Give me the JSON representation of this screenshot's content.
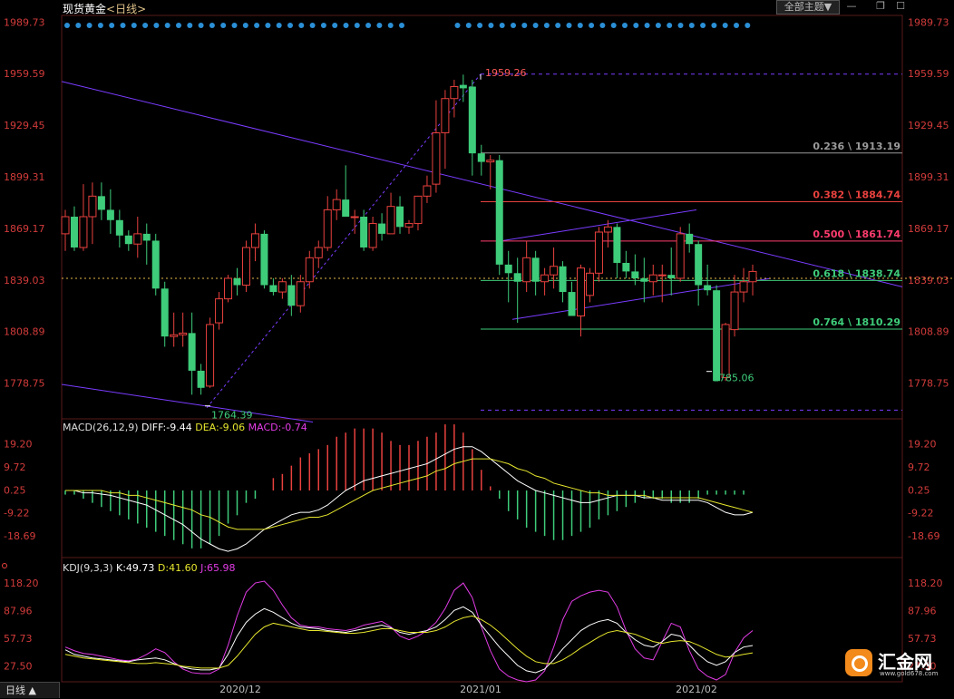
{
  "header": {
    "title": "现货黄金",
    "title_sub": "<日线>",
    "theme_label": "全部主题▼",
    "win_min": "—",
    "win_restore": "❐",
    "win_close": "☐"
  },
  "colors": {
    "up": "#e8413e",
    "down": "#3ecc7a",
    "bg": "#000000",
    "axis_text": "#d33b3b",
    "trend": "#7a3cff",
    "white_line": "#ffffff",
    "yellow_line": "#e6e62e",
    "magenta_line": "#e23ce6",
    "dot": "#2b8fd6"
  },
  "chart_data": [
    {
      "type": "candlestick",
      "title": "现货黄金 日线",
      "ylim": [
        1760,
        1992
      ],
      "y_ticks": [
        "1989.73",
        "1959.59",
        "1929.45",
        "1899.31",
        "1869.17",
        "1839.03",
        "1808.89",
        "1778.75"
      ],
      "x_ticks": [
        "2020/12",
        "2021/01",
        "2021/02"
      ],
      "current_price": 1840,
      "fib_levels": [
        {
          "label": "0.236 \\ 1913.19",
          "value": 1913.19,
          "color": "#9a9a9a"
        },
        {
          "label": "0.382 \\ 1884.74",
          "value": 1884.74,
          "color": "#e8413e"
        },
        {
          "label": "0.500 \\ 1861.74",
          "value": 1861.74,
          "color": "#ff3c6e"
        },
        {
          "label": "0.618 \\ 1838.74",
          "value": 1838.74,
          "color": "#3ecc7a"
        },
        {
          "label": "0.764 \\ 1810.29",
          "value": 1810.29,
          "color": "#3ecc7a"
        }
      ],
      "annotations": [
        {
          "label": "1959.26",
          "value": 1959.26
        },
        {
          "label": "1764.39",
          "value": 1764.39
        },
        {
          "label": "1785.06",
          "value": 1785.06
        }
      ],
      "ohlc": [
        [
          1866,
          1880,
          1856,
          1876
        ],
        [
          1876,
          1882,
          1856,
          1858
        ],
        [
          1858,
          1895,
          1856,
          1876
        ],
        [
          1876,
          1896,
          1860,
          1888
        ],
        [
          1888,
          1896,
          1874,
          1880
        ],
        [
          1880,
          1892,
          1866,
          1874
        ],
        [
          1874,
          1880,
          1858,
          1865
        ],
        [
          1865,
          1868,
          1856,
          1860
        ],
        [
          1860,
          1876,
          1852,
          1866
        ],
        [
          1866,
          1872,
          1848,
          1862
        ],
        [
          1862,
          1866,
          1830,
          1834
        ],
        [
          1834,
          1838,
          1800,
          1806
        ],
        [
          1806,
          1820,
          1800,
          1807
        ],
        [
          1807,
          1820,
          1800,
          1808
        ],
        [
          1808,
          1820,
          1772,
          1786
        ],
        [
          1786,
          1790,
          1772,
          1776
        ],
        [
          1777,
          1817,
          1776,
          1813
        ],
        [
          1814,
          1832,
          1810,
          1828
        ],
        [
          1828,
          1842,
          1826,
          1840
        ],
        [
          1840,
          1846,
          1830,
          1836
        ],
        [
          1836,
          1862,
          1832,
          1858
        ],
        [
          1858,
          1872,
          1850,
          1866
        ],
        [
          1866,
          1868,
          1834,
          1836
        ],
        [
          1836,
          1840,
          1830,
          1832
        ],
        [
          1832,
          1840,
          1828,
          1838
        ],
        [
          1836,
          1842,
          1818,
          1824
        ],
        [
          1824,
          1842,
          1820,
          1838
        ],
        [
          1838,
          1856,
          1834,
          1852
        ],
        [
          1852,
          1862,
          1846,
          1858
        ],
        [
          1858,
          1888,
          1856,
          1880
        ],
        [
          1880,
          1892,
          1874,
          1886
        ],
        [
          1886,
          1906,
          1876,
          1876
        ],
        [
          1876,
          1880,
          1866,
          1876
        ],
        [
          1876,
          1880,
          1856,
          1858
        ],
        [
          1858,
          1876,
          1856,
          1872
        ],
        [
          1872,
          1878,
          1862,
          1866
        ],
        [
          1866,
          1890,
          1866,
          1882
        ],
        [
          1882,
          1888,
          1866,
          1870
        ],
        [
          1870,
          1874,
          1866,
          1872
        ],
        [
          1872,
          1888,
          1868,
          1888
        ],
        [
          1888,
          1900,
          1884,
          1894
        ],
        [
          1895,
          1944,
          1890,
          1925
        ],
        [
          1925,
          1950,
          1904,
          1945
        ],
        [
          1945,
          1956,
          1934,
          1952
        ],
        [
          1953,
          1959,
          1943,
          1951
        ],
        [
          1952,
          1956,
          1900,
          1913
        ],
        [
          1913,
          1918,
          1900,
          1908
        ],
        [
          1908,
          1912,
          1892,
          1909
        ],
        [
          1909,
          1912,
          1842,
          1848
        ],
        [
          1848,
          1856,
          1826,
          1843
        ],
        [
          1843,
          1852,
          1814,
          1838
        ],
        [
          1838,
          1862,
          1832,
          1852
        ],
        [
          1852,
          1856,
          1830,
          1838
        ],
        [
          1838,
          1846,
          1830,
          1842
        ],
        [
          1842,
          1858,
          1834,
          1847
        ],
        [
          1847,
          1850,
          1826,
          1832
        ],
        [
          1832,
          1838,
          1820,
          1818
        ],
        [
          1818,
          1848,
          1806,
          1846
        ],
        [
          1830,
          1846,
          1826,
          1843
        ],
        [
          1843,
          1870,
          1838,
          1867
        ],
        [
          1867,
          1874,
          1858,
          1870
        ],
        [
          1870,
          1872,
          1840,
          1849
        ],
        [
          1849,
          1856,
          1840,
          1844
        ],
        [
          1844,
          1854,
          1836,
          1840
        ],
        [
          1840,
          1852,
          1826,
          1838
        ],
        [
          1838,
          1848,
          1830,
          1842
        ],
        [
          1842,
          1848,
          1826,
          1842
        ],
        [
          1842,
          1858,
          1830,
          1840
        ],
        [
          1840,
          1870,
          1838,
          1866
        ],
        [
          1866,
          1872,
          1855,
          1860
        ],
        [
          1860,
          1862,
          1824,
          1836
        ],
        [
          1836,
          1848,
          1830,
          1833
        ],
        [
          1833,
          1836,
          1796,
          1780
        ],
        [
          1782,
          1814,
          1780,
          1813
        ],
        [
          1810,
          1842,
          1806,
          1832
        ],
        [
          1832,
          1846,
          1826,
          1838
        ],
        [
          1838,
          1848,
          1830,
          1844
        ]
      ]
    },
    {
      "type": "bar",
      "title": "MACD(26,12,9)",
      "series": [
        {
          "name": "DIFF",
          "label": "DIFF:-9.44"
        },
        {
          "name": "DEA",
          "label": "DEA:-9.06"
        },
        {
          "name": "MACD",
          "label": "MACD:-0.74"
        }
      ],
      "ylim": [
        -22,
        22
      ],
      "y_ticks": [
        "19.20",
        "9.72",
        "0.25",
        "-9.22",
        "-18.69"
      ],
      "diff": [
        0,
        0,
        -1,
        -1,
        -1.5,
        -2,
        -3,
        -4,
        -5,
        -6,
        -8,
        -10,
        -12,
        -14,
        -17,
        -20,
        -22,
        -24,
        -25,
        -24,
        -22,
        -19,
        -16,
        -14,
        -12,
        -10,
        -9,
        -9,
        -8,
        -6,
        -3,
        0,
        2,
        4,
        5,
        6,
        7,
        8,
        9,
        10,
        11,
        13,
        15,
        17,
        18,
        18,
        16,
        13,
        10,
        7,
        4,
        2,
        0,
        -1,
        -2,
        -3,
        -4,
        -5,
        -5,
        -4,
        -3,
        -2,
        -2,
        -2,
        -3,
        -3,
        -4,
        -4,
        -4,
        -4,
        -4,
        -5,
        -7,
        -9,
        -10,
        -10,
        -9
      ],
      "dea": [
        0,
        0,
        0,
        0,
        0,
        -1,
        -1,
        -2,
        -2,
        -3,
        -4,
        -5,
        -6,
        -7,
        -8,
        -10,
        -11,
        -13,
        -15,
        -16,
        -16,
        -16,
        -16,
        -15,
        -14,
        -13,
        -12,
        -11,
        -11,
        -10,
        -8,
        -6,
        -4,
        -2,
        0,
        1,
        2,
        3,
        4,
        5,
        6,
        8,
        9,
        11,
        12,
        13,
        13,
        13,
        12,
        11,
        9,
        8,
        6,
        5,
        3,
        2,
        1,
        0,
        -1,
        -1,
        -2,
        -2,
        -2,
        -2,
        -2,
        -3,
        -3,
        -3,
        -3,
        -3,
        -3,
        -4,
        -5,
        -6,
        -7,
        -8,
        -9
      ],
      "macd": [
        -1,
        -1,
        -2,
        -3,
        -4,
        -5,
        -6,
        -7,
        -8,
        -9,
        -10,
        -11,
        -12,
        -13,
        -14,
        -14,
        -13,
        -11,
        -8,
        -6,
        -3,
        -2,
        0,
        3,
        4,
        6,
        8,
        9,
        10,
        11,
        13,
        14,
        15,
        15,
        15,
        14,
        12,
        11,
        11,
        12,
        13,
        14,
        16,
        16,
        14,
        10,
        5,
        1,
        -2,
        -5,
        -7,
        -9,
        -10,
        -11,
        -12,
        -12,
        -11,
        -10,
        -9,
        -7,
        -6,
        -5,
        -4,
        -3,
        -2,
        -2,
        -2,
        -3,
        -3,
        -3,
        -2,
        -1,
        -1,
        -1,
        -1,
        -1
      ]
    },
    {
      "type": "line",
      "title": "KDJ(9,3,3)",
      "series": [
        {
          "name": "K",
          "label": "K:49.73"
        },
        {
          "name": "D",
          "label": "D:41.60"
        },
        {
          "name": "J",
          "label": "J:65.98"
        }
      ],
      "ylim": [
        14,
        124
      ],
      "y_ticks": [
        "118.20",
        "87.96",
        "57.73",
        "27.50"
      ],
      "k": [
        45,
        40,
        38,
        36,
        35,
        34,
        33,
        32,
        34,
        35,
        36,
        34,
        30,
        26,
        24,
        23,
        23,
        25,
        40,
        60,
        75,
        84,
        90,
        86,
        80,
        74,
        70,
        69,
        68,
        66,
        65,
        64,
        66,
        68,
        70,
        72,
        69,
        64,
        62,
        64,
        66,
        70,
        78,
        88,
        92,
        86,
        72,
        60,
        48,
        38,
        28,
        22,
        20,
        24,
        34,
        46,
        56,
        66,
        72,
        76,
        78,
        74,
        64,
        56,
        50,
        48,
        54,
        62,
        60,
        50,
        40,
        32,
        28,
        32,
        42,
        48,
        49.73
      ],
      "d": [
        40,
        38,
        36,
        35,
        34,
        33,
        32,
        31,
        30,
        30,
        31,
        30,
        29,
        27,
        26,
        25,
        25,
        25,
        28,
        38,
        50,
        62,
        70,
        74,
        72,
        70,
        68,
        66,
        66,
        65,
        64,
        63,
        63,
        64,
        66,
        68,
        68,
        66,
        64,
        64,
        64,
        66,
        70,
        76,
        80,
        82,
        78,
        72,
        64,
        55,
        46,
        38,
        32,
        30,
        30,
        34,
        40,
        47,
        53,
        59,
        64,
        66,
        64,
        62,
        58,
        54,
        52,
        54,
        55,
        54,
        50,
        45,
        40,
        37,
        38,
        40,
        41.6
      ],
      "j": [
        48,
        44,
        41,
        40,
        38,
        36,
        34,
        33,
        35,
        40,
        46,
        42,
        32,
        24,
        20,
        19,
        19,
        24,
        50,
        82,
        108,
        118,
        120,
        110,
        94,
        80,
        72,
        70,
        70,
        68,
        67,
        66,
        68,
        72,
        74,
        76,
        70,
        60,
        56,
        60,
        66,
        75,
        90,
        110,
        118,
        102,
        70,
        44,
        24,
        16,
        12,
        10,
        12,
        22,
        48,
        78,
        98,
        104,
        108,
        110,
        108,
        92,
        66,
        46,
        36,
        34,
        54,
        74,
        70,
        44,
        24,
        16,
        12,
        18,
        42,
        58,
        65.98
      ]
    }
  ],
  "indicators": {
    "macd_label": "MACD(26,12,9)",
    "macd_diff": "DIFF:-9.44",
    "macd_dea": "DEA:-9.06",
    "macd_val": "MACD:-0.74",
    "kdj_label": "KDJ(9,3,3)",
    "kdj_k": "K:49.73",
    "kdj_d": "D:41.60",
    "kdj_j": "J:65.98"
  },
  "footer": {
    "tab_label": "日线 ▲"
  },
  "logo": {
    "name": "汇金网",
    "url": "www.gold678.com"
  }
}
